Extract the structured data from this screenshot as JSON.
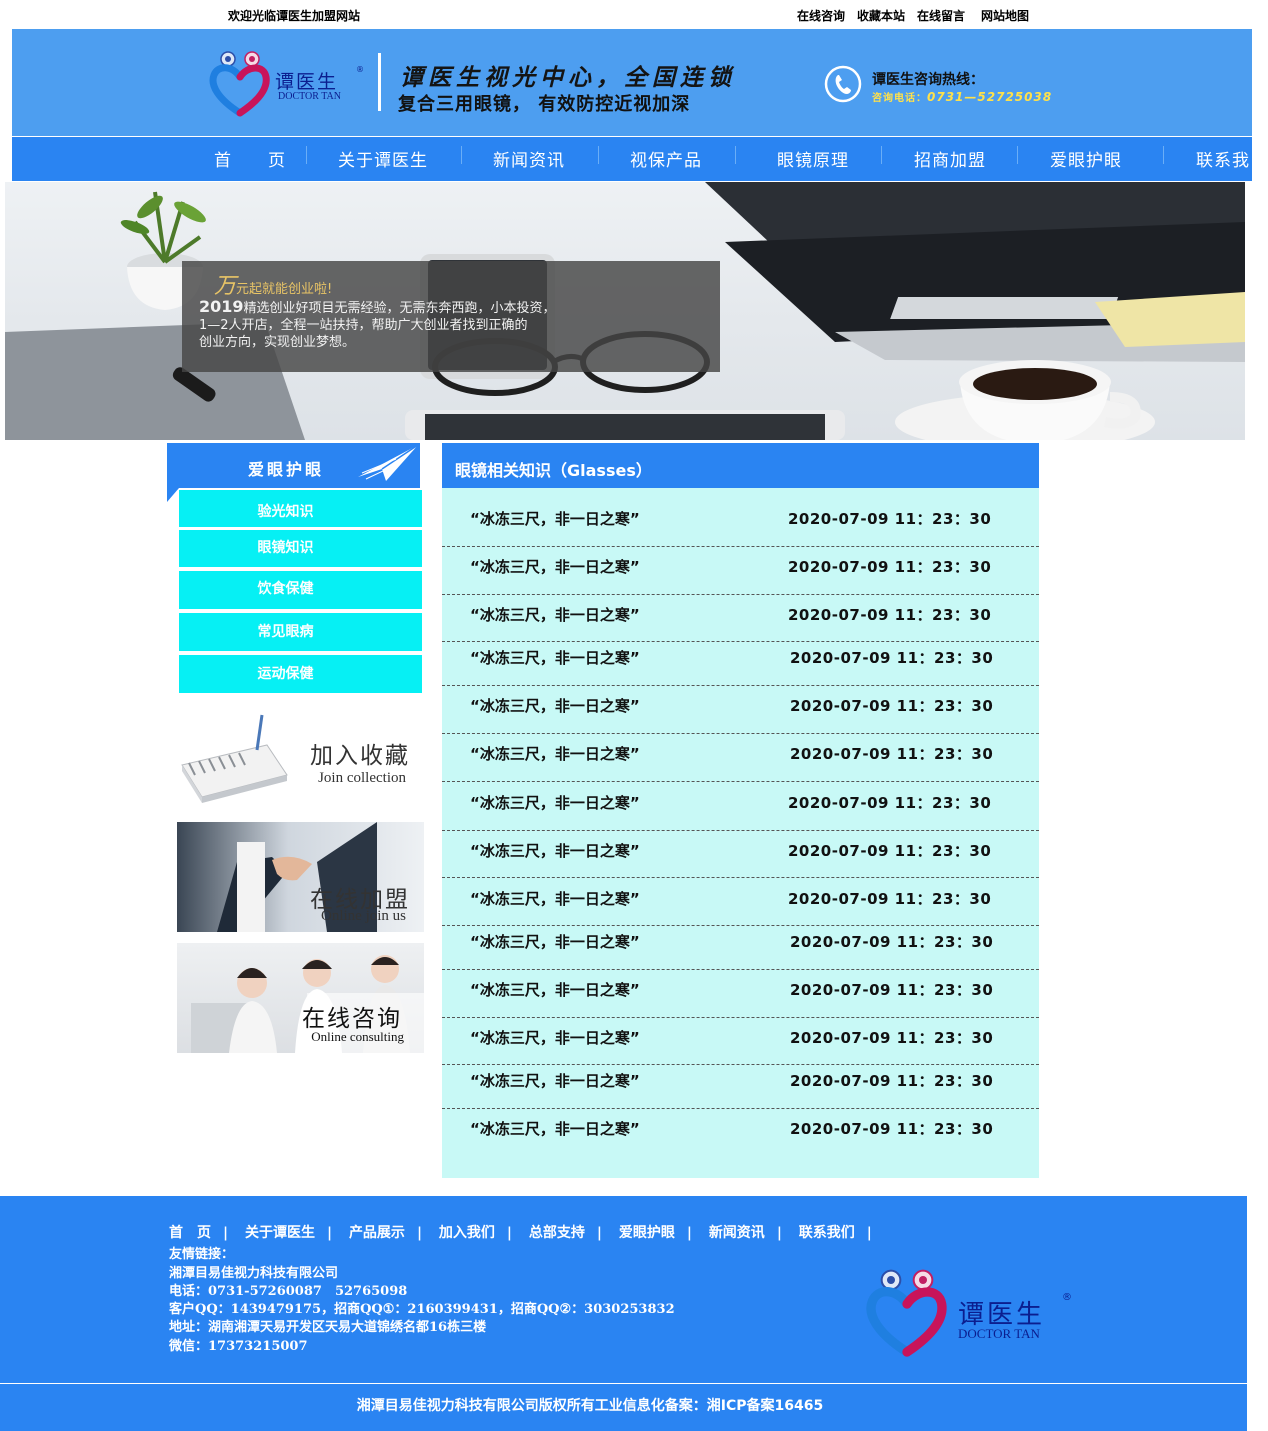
{
  "topbar": {
    "welcome": "欢迎光临谭医生加盟网站",
    "links": [
      "在线咨询",
      "收藏本站",
      "在线留言",
      "网站地图"
    ]
  },
  "header": {
    "logo_name": "谭医生",
    "logo_en": "DOCTOR TAN",
    "logo_reg": "®",
    "slogan_line1": "谭医生视光中心，全国连锁",
    "slogan_line2": "复合三用眼镜， 有效防控近视加深",
    "hotline_title": "谭医生咨询热线：",
    "hotline_label": "咨询电话：",
    "hotline_number": "0731—52725038"
  },
  "nav": {
    "items": [
      "首　　页",
      "关于谭医生",
      "新闻资讯",
      "视保产品",
      "眼镜原理",
      "招商加盟",
      "爱眼护眼",
      "联系我"
    ]
  },
  "banner": {
    "caption_big": "万",
    "caption_title": "元起就能创业啦!",
    "caption_year": "2019",
    "caption_line1": "精选创业好项目无需经验，无需东奔西跑，小本投资，",
    "caption_line2": "1—2人开店，全程一站扶持，帮助广大创业者找到正确的",
    "caption_line3": "创业方向，实现创业梦想。"
  },
  "sidebar": {
    "title": "爱眼护眼",
    "items": [
      "验光知识",
      "眼镜知识",
      "饮食保健",
      "常见眼病",
      "运动保健"
    ],
    "promos": [
      {
        "cn": "加入收藏",
        "en": "Join collection"
      },
      {
        "cn": "在线加盟",
        "en": "Online join us"
      },
      {
        "cn": "在线咨询",
        "en": "Online consulting"
      }
    ]
  },
  "main": {
    "title": "眼镜相关知识（Glasses）",
    "rows": [
      {
        "title": "“冰冻三尺，非一日之寒”",
        "date": "2020-07-09  11：23：30"
      },
      {
        "title": "“冰冻三尺，非一日之寒”",
        "date": "2020-07-09  11：23：30"
      },
      {
        "title": "“冰冻三尺，非一日之寒”",
        "date": "2020-07-09  11：23：30"
      },
      {
        "title": "“冰冻三尺，非一日之寒”",
        "date": "2020-07-09  11：23：30"
      },
      {
        "title": "“冰冻三尺，非一日之寒”",
        "date": "2020-07-09  11：23：30"
      },
      {
        "title": "“冰冻三尺，非一日之寒”",
        "date": "2020-07-09  11：23：30"
      },
      {
        "title": "“冰冻三尺，非一日之寒”",
        "date": "2020-07-09  11：23：30"
      },
      {
        "title": "“冰冻三尺，非一日之寒”",
        "date": "2020-07-09  11：23：30"
      },
      {
        "title": "“冰冻三尺，非一日之寒”",
        "date": "2020-07-09  11：23：30"
      },
      {
        "title": "“冰冻三尺，非一日之寒”",
        "date": "2020-07-09  11：23：30"
      },
      {
        "title": "“冰冻三尺，非一日之寒”",
        "date": "2020-07-09  11：23：30"
      },
      {
        "title": "“冰冻三尺，非一日之寒”",
        "date": "2020-07-09  11：23：30"
      },
      {
        "title": "“冰冻三尺，非一日之寒”",
        "date": "2020-07-09  11：23：30"
      },
      {
        "title": "“冰冻三尺，非一日之寒”",
        "date": "2020-07-09  11：23：30"
      }
    ]
  },
  "footer": {
    "nav": [
      "首　页",
      "关于谭医生",
      "产品展示",
      "加入我们",
      "总部支持",
      "爱眼护眼",
      "新闻资讯",
      "联系我们"
    ],
    "separator": "|",
    "links_label": "友情链接：",
    "company": "湘潭目易佳视力科技有限公司",
    "phone": "电话：0731-57260087　52765098",
    "qq": "客户QQ：1439479175，招商QQ①：2160399431，招商QQ②：3030253832",
    "address": "地址：湖南湘潭天易开发区天易大道锦绣名都16栋三楼",
    "wechat": "微信：17373215007",
    "logo_name": "谭医生",
    "logo_en": "DOCTOR TAN",
    "logo_reg": "®",
    "copyright": "湘潭目易佳视力科技有限公司版权所有工业信息化备案：湘ICP备案16465"
  },
  "colors": {
    "header_bg": "#4d9ef0",
    "nav_bg": "#2a84f2",
    "sidebar_item_bg": "#06f0f4",
    "list_bg": "#c8f9f6",
    "hotline_number": "#ffe14a"
  },
  "icons": [
    "logo-heart-icon",
    "phone-icon",
    "paper-plane-icon"
  ]
}
